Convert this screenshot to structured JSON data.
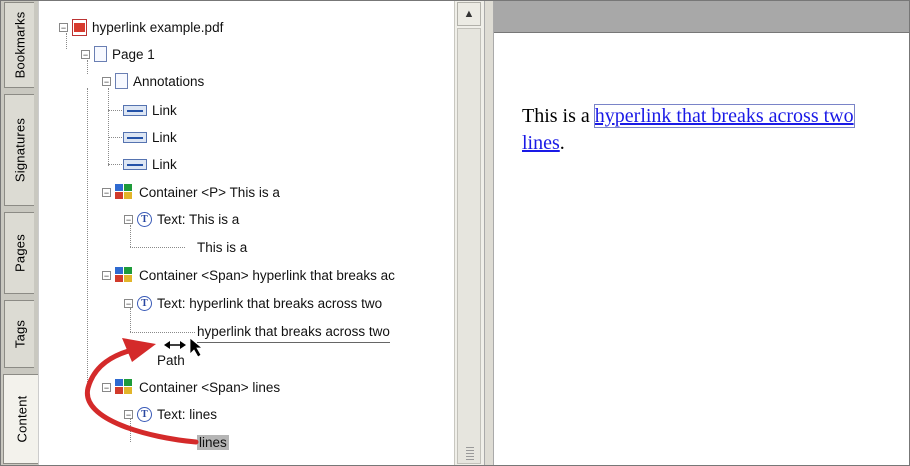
{
  "tabs": [
    {
      "label": "Bookmarks"
    },
    {
      "label": "Signatures"
    },
    {
      "label": "Pages"
    },
    {
      "label": "Tags"
    },
    {
      "label": "Content"
    }
  ],
  "tree": {
    "root": "hyperlink example.pdf",
    "page": "Page 1",
    "annotations": "Annotations",
    "links": [
      "Link",
      "Link",
      "Link"
    ],
    "container1": "Container <P> This is a",
    "text1": "Text: This is a",
    "leaf1": "This is a",
    "container2": "Container <Span> hyperlink that breaks ac",
    "text2": "Text: hyperlink that breaks across two",
    "leaf2": "hyperlink that breaks across two",
    "path": "Path",
    "container3": "Container <Span> lines",
    "text3": "Text: lines",
    "leaf3": "lines"
  },
  "document": {
    "before": "This is a ",
    "link_line1": "hyperlink that breaks across two",
    "link_line2": "lines",
    "after": "."
  },
  "colors": {
    "link": "#1a1ae6",
    "arrow": "#d42a2a",
    "doc_header": "#a8a8a8"
  }
}
